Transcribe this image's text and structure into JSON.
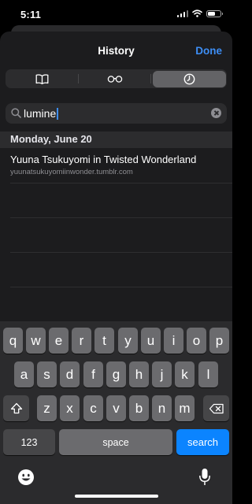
{
  "status": {
    "time": "5:11"
  },
  "nav": {
    "title": "History",
    "done_label": "Done"
  },
  "tabs": [
    {
      "icon": "book-icon",
      "selected": false
    },
    {
      "icon": "glasses-icon",
      "selected": false
    },
    {
      "icon": "clock-icon",
      "selected": true
    }
  ],
  "search": {
    "value": "lumine"
  },
  "section": {
    "header": "Monday, June 20"
  },
  "history": [
    {
      "title": "Yuuna Tsukuyomi in Twisted Wonderland",
      "url": "yuunatsukuyomiinwonder.tumblr.com"
    }
  ],
  "keyboard": {
    "row1": [
      "q",
      "w",
      "e",
      "r",
      "t",
      "y",
      "u",
      "i",
      "o",
      "p"
    ],
    "row2": [
      "a",
      "s",
      "d",
      "f",
      "g",
      "h",
      "j",
      "k",
      "l"
    ],
    "row3": [
      "z",
      "x",
      "c",
      "v",
      "b",
      "n",
      "m"
    ],
    "numbers_label": "123",
    "space_label": "space",
    "search_label": "search"
  },
  "colors": {
    "accent": "#3d8ef5",
    "search_key": "#0b84ff"
  }
}
